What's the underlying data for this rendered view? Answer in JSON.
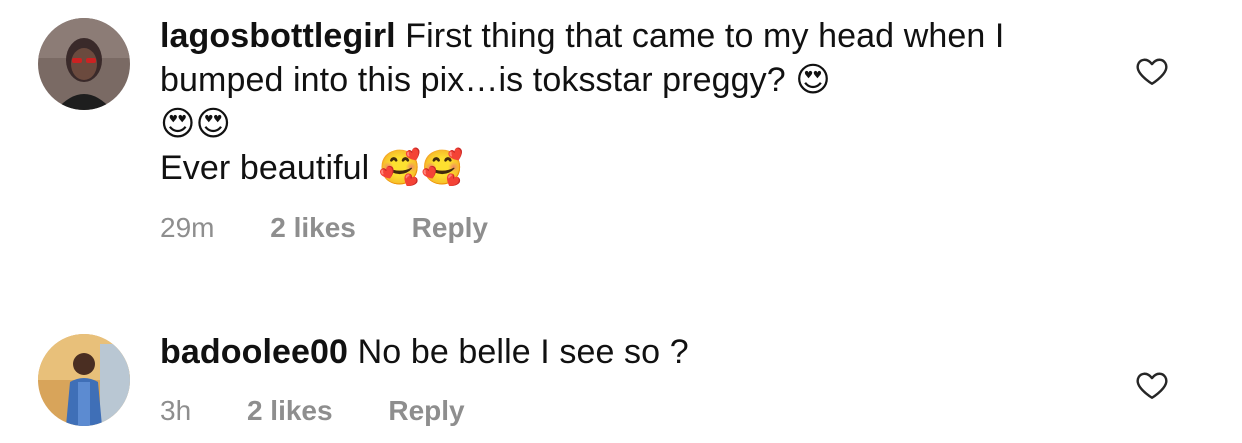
{
  "comments": [
    {
      "username": "lagosbottlegirl",
      "text_line1": "First thing that came to my head when I bumped into this pix…is toksstar preggy?",
      "emoji_a": "😍",
      "emoji_b": "😍😍",
      "text_line2": "Ever beautiful",
      "emoji_c": "🥰🥰",
      "time": "29m",
      "likes": "2 likes",
      "reply_label": "Reply",
      "avatar_icon": "user-avatar-icon"
    },
    {
      "username": "badoolee00",
      "text": "No be belle I see so ?",
      "time": "3h",
      "likes": "2 likes",
      "reply_label": "Reply",
      "avatar_icon": "user-avatar-icon"
    }
  ],
  "colors": {
    "text": "#111111",
    "meta": "#8e8e8e",
    "heart_stroke": "#262626"
  }
}
